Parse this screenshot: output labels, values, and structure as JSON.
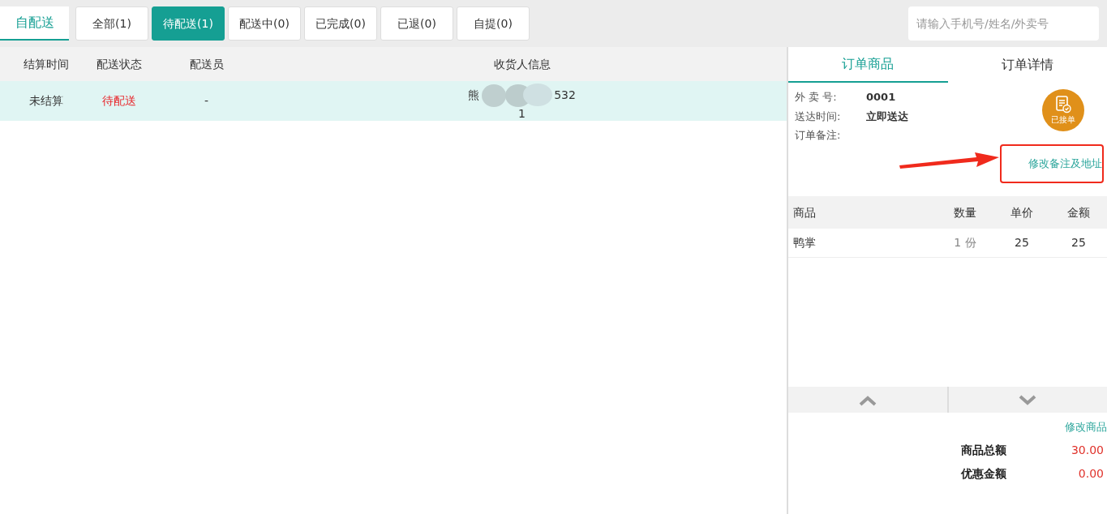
{
  "mode_tab": {
    "label": "自配送",
    "selected": true
  },
  "filters": [
    {
      "label": "全部(1)",
      "selected": false
    },
    {
      "label": "待配送(1)",
      "selected": true
    },
    {
      "label": "配送中(0)",
      "selected": false
    },
    {
      "label": "已完成(0)",
      "selected": false
    },
    {
      "label": "已退(0)",
      "selected": false
    },
    {
      "label": "自提(0)",
      "selected": false
    }
  ],
  "search": {
    "placeholder": "请输入手机号/姓名/外卖号"
  },
  "orders_table": {
    "columns": [
      "结算时间",
      "配送状态",
      "配送员",
      "收货人信息"
    ],
    "rows": [
      {
        "settle_time": "未结算",
        "status": "待配送",
        "courier": "-",
        "receiver_line_1_start": "熊",
        "receiver_line_1_end": "532",
        "receiver_line_2": "1",
        "selected": true
      }
    ]
  },
  "detail_tabs": [
    {
      "label": "订单商品",
      "selected": true
    },
    {
      "label": "订单详情",
      "selected": false
    }
  ],
  "fields": [
    {
      "label": "外 卖  号:",
      "value": "0001"
    },
    {
      "label": "送达时间:",
      "value": "立即送达"
    },
    {
      "label": "订单备注:"
    }
  ],
  "status_badge": {
    "label": "已接单"
  },
  "edit_note_link": "修改备注及地址",
  "goods_table": {
    "columns": [
      "商品",
      "数量",
      "单价",
      "金额"
    ],
    "rows": [
      {
        "name": "鸭掌",
        "qty": "1",
        "unit": "份",
        "price": "25",
        "amount": "25"
      }
    ]
  },
  "edit_goods_link": "修改商品",
  "totals": [
    {
      "label": "商品总额",
      "value": "30.00"
    },
    {
      "label": "优惠金额",
      "value": "0.00"
    }
  ]
}
